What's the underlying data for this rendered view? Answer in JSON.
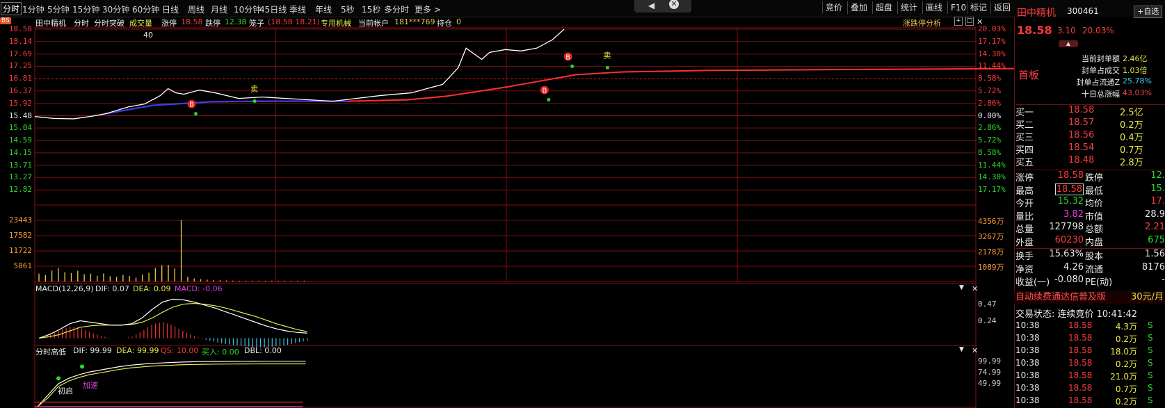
{
  "toolbar": {
    "periods": [
      "分时",
      "1分钟",
      "5分钟",
      "15分钟",
      "30分钟",
      "60分钟",
      "日线",
      "周线",
      "月线",
      "10分钟",
      "45日线",
      "季线",
      "年线",
      "5秒",
      "15秒",
      "多分时",
      "更多 >"
    ],
    "tools": [
      "竞价",
      "叠加",
      "超盘",
      "统计",
      "画线",
      "F10",
      "标记",
      "返回"
    ]
  },
  "chart_header": {
    "stock_name": "田中精机",
    "mode": "分时",
    "strategy": "分时突破",
    "volume_label": "成交量",
    "limit_up_label": "涨停",
    "limit_up_value": "18.58",
    "limit_down_label": "跌停",
    "limit_down_value": "12.38",
    "cage_label": "笼子",
    "cage_value": "(18.58 18.21)",
    "sector": "专用机械",
    "account_label": "当前帐户",
    "account_value": "181***769",
    "position_label": "持仓",
    "position_value": "0",
    "analysis_link": "涨跌停分析",
    "peak_marker": "40",
    "bs_tag": "BS"
  },
  "chart_data": [
    {
      "type": "line",
      "name_hidden": true,
      "y_ticks_left": [
        "18.58",
        "18.14",
        "17.69",
        "17.25",
        "16.81",
        "16.37",
        "15.92",
        "15.48",
        "15.04",
        "14.59",
        "14.15",
        "13.71",
        "13.27",
        "12.82"
      ],
      "y_ticks_right": [
        "20.03%",
        "17.17%",
        "14.30%",
        "11.44%",
        "8.58%",
        "5.72%",
        "2.86%",
        "0.00%",
        "2.86%",
        "5.72%",
        "8.58%",
        "11.44%",
        "14.30%",
        "17.17%"
      ],
      "ylim": [
        12.38,
        18.58
      ],
      "prev_close": 15.48,
      "price_series": [
        [
          0,
          15.45
        ],
        [
          5,
          15.38
        ],
        [
          10,
          15.37
        ],
        [
          14,
          15.45
        ],
        [
          18,
          15.55
        ],
        [
          24,
          15.8
        ],
        [
          28,
          15.9
        ],
        [
          32,
          16.2
        ],
        [
          34,
          16.45
        ],
        [
          36,
          16.3
        ],
        [
          38,
          16.25
        ],
        [
          42,
          16.4
        ],
        [
          46,
          16.3
        ],
        [
          52,
          16.1
        ],
        [
          58,
          16.15
        ],
        [
          64,
          16.1
        ],
        [
          70,
          16.05
        ],
        [
          76,
          16.0
        ],
        [
          82,
          16.1
        ],
        [
          88,
          16.2
        ],
        [
          96,
          16.3
        ],
        [
          100,
          16.45
        ],
        [
          104,
          16.6
        ],
        [
          108,
          17.2
        ],
        [
          110,
          17.9
        ],
        [
          112,
          17.7
        ],
        [
          114,
          17.5
        ],
        [
          116,
          17.75
        ],
        [
          120,
          17.85
        ],
        [
          124,
          17.8
        ],
        [
          128,
          17.9
        ],
        [
          132,
          18.2
        ],
        [
          135,
          18.58
        ]
      ],
      "avg_series": [
        [
          18,
          15.55
        ],
        [
          30,
          15.85
        ],
        [
          45,
          15.98
        ],
        [
          60,
          16.0
        ],
        [
          80,
          16.0
        ],
        [
          95,
          16.05
        ],
        [
          105,
          16.18
        ],
        [
          120,
          16.5
        ],
        [
          130,
          16.75
        ],
        [
          138,
          16.95
        ],
        [
          150,
          17.05
        ],
        [
          170,
          17.1
        ],
        [
          200,
          17.13
        ],
        [
          240,
          17.16
        ],
        [
          280,
          17.2
        ],
        [
          320,
          17.22
        ],
        [
          380,
          17.24
        ]
      ],
      "markers": [
        {
          "label": "B",
          "x": 40,
          "y": 15.9
        },
        {
          "label": "卖",
          "x": 55,
          "y": 16.35
        },
        {
          "label": "B",
          "x": 130,
          "y": 16.4
        },
        {
          "label": "B",
          "x": 136,
          "y": 17.6
        },
        {
          "label": "卖",
          "x": 145,
          "y": 17.55
        }
      ],
      "total_minutes": 240
    },
    {
      "type": "bar",
      "name": "成交量",
      "y_ticks_left": [
        "23443",
        "17582",
        "11722",
        "5861"
      ],
      "y_ticks_right": [
        "4356万",
        "3267万",
        "2178万",
        "1089万"
      ],
      "ylim": [
        0,
        29300
      ],
      "values": [
        3000,
        2500,
        4200,
        5200,
        3600,
        3200,
        4100,
        2800,
        3000,
        2200,
        3100,
        2000,
        1800,
        2500,
        2100,
        1500,
        2600,
        3300,
        5200,
        6200,
        6400,
        5000,
        23443,
        1800,
        1200,
        900,
        700,
        600,
        500,
        400,
        350,
        300,
        300,
        300,
        300,
        300,
        300,
        300,
        300,
        300,
        300,
        300
      ]
    },
    {
      "type": "line",
      "name": "MACD",
      "params": "MACD(12,26,9)",
      "dif_label": "DIF: 0.07",
      "dea_label": "DEA: 0.09",
      "macd_label": "MACD: -0.06",
      "y_ticks_right": [
        "0.47",
        "0.24"
      ],
      "dif": [
        0.0,
        0.05,
        0.12,
        0.2,
        0.24,
        0.22,
        0.2,
        0.18,
        0.18,
        0.2,
        0.28,
        0.4,
        0.5,
        0.54,
        0.53,
        0.5,
        0.46,
        0.42,
        0.37,
        0.32,
        0.27,
        0.22,
        0.17,
        0.13,
        0.1,
        0.08,
        0.07
      ],
      "dea": [
        0.0,
        0.02,
        0.05,
        0.1,
        0.15,
        0.17,
        0.18,
        0.18,
        0.18,
        0.19,
        0.22,
        0.28,
        0.36,
        0.43,
        0.47,
        0.48,
        0.47,
        0.45,
        0.42,
        0.38,
        0.34,
        0.3,
        0.25,
        0.2,
        0.16,
        0.12,
        0.09
      ],
      "ylim": [
        -0.12,
        0.62
      ]
    },
    {
      "type": "line",
      "name": "分时高低",
      "dif_label": "DIF: 99.99",
      "dea_label": "DEA: 99.99",
      "qs_label": "QS: 10.00",
      "buy_label": "买入: 0.00",
      "dbl_label": "DBL: 0.00",
      "y_ticks_right": [
        "99.99",
        "74.99",
        "49.99"
      ],
      "dif": [
        0,
        25,
        50,
        62,
        70,
        76,
        80,
        84,
        88,
        91,
        93,
        95,
        96,
        97,
        98,
        98.5,
        99,
        99.3,
        99.5,
        99.7,
        99.8,
        99.9,
        99.99,
        99.99,
        99.99,
        99.99,
        99.99
      ],
      "ylim": [
        0,
        110
      ],
      "annotations": [
        "初启",
        "加速"
      ]
    }
  ],
  "quote": {
    "name": "田中精机",
    "code": "300461",
    "add_btn": "+自选",
    "price": "18.58",
    "change": "3.10",
    "change_pct": "20.03%",
    "board_tag": "首板",
    "seal": [
      {
        "label": "当前封单额",
        "value": "2.46亿"
      },
      {
        "label": "封单占成交",
        "value": "1.03倍"
      },
      {
        "label": "封单占流通Z",
        "value": "25.78%"
      },
      {
        "label": "十日总涨幅",
        "value": "43.03%"
      }
    ],
    "bids": [
      {
        "label": "买一",
        "price": "18.58",
        "vol": "2.5亿"
      },
      {
        "label": "买二",
        "price": "18.57",
        "vol": "0.2万"
      },
      {
        "label": "买三",
        "price": "18.56",
        "vol": "0.4万"
      },
      {
        "label": "买四",
        "price": "18.54",
        "vol": "0.7万"
      },
      {
        "label": "买五",
        "price": "18.48",
        "vol": "2.8万"
      }
    ],
    "stats": [
      {
        "l1": "涨停",
        "v1": "18.58",
        "l2": "跌停",
        "v2": "12."
      },
      {
        "l1": "最高",
        "v1": "18.58",
        "l2": "最低",
        "v2": "15."
      },
      {
        "l1": "今开",
        "v1": "15.32",
        "l2": "均价",
        "v2": "17."
      },
      {
        "l1": "量比",
        "v1": "3.82",
        "l2": "市值",
        "v2": "28.9"
      },
      {
        "l1": "总量",
        "v1": "127798",
        "l2": "总额",
        "v2": "2.21"
      },
      {
        "l1": "外盘",
        "v1": "60230",
        "l2": "内盘",
        "v2": "675"
      }
    ],
    "stats2": [
      {
        "l1": "换手",
        "v1": "15.63%",
        "l2": "股本",
        "v2": "1.56"
      },
      {
        "l1": "净资",
        "v1": "4.26",
        "l2": "流通",
        "v2": "8176"
      },
      {
        "l1": "收益(一)",
        "v1": "-0.080",
        "l2": "PE(动)",
        "v2": "-"
      }
    ],
    "ad_text": "自动续费通达信普及版",
    "ad_price": "30元/月",
    "trade_status": "交易状态: 连续竞价 10:41:42",
    "ticks": [
      {
        "time": "10:38",
        "price": "18.58",
        "vol": "4.3万",
        "side": "S"
      },
      {
        "time": "10:38",
        "price": "18.58",
        "vol": "0.2万",
        "side": "S"
      },
      {
        "time": "10:38",
        "price": "18.58",
        "vol": "18.0万",
        "side": "S"
      },
      {
        "time": "10:38",
        "price": "18.58",
        "vol": "0.2万",
        "side": "S"
      },
      {
        "time": "10:38",
        "price": "18.58",
        "vol": "21.0万",
        "side": "S"
      },
      {
        "time": "10:38",
        "price": "18.58",
        "vol": "0.7万",
        "side": "S"
      },
      {
        "time": "10:38",
        "price": "18.58",
        "vol": "0.2万",
        "side": "S"
      }
    ]
  },
  "colors": {
    "up": "#ff3b3b",
    "down": "#2bd92b",
    "grid": "#7a0f0f",
    "price_line": "#ffffff",
    "avg_line": "#e8e84a"
  }
}
